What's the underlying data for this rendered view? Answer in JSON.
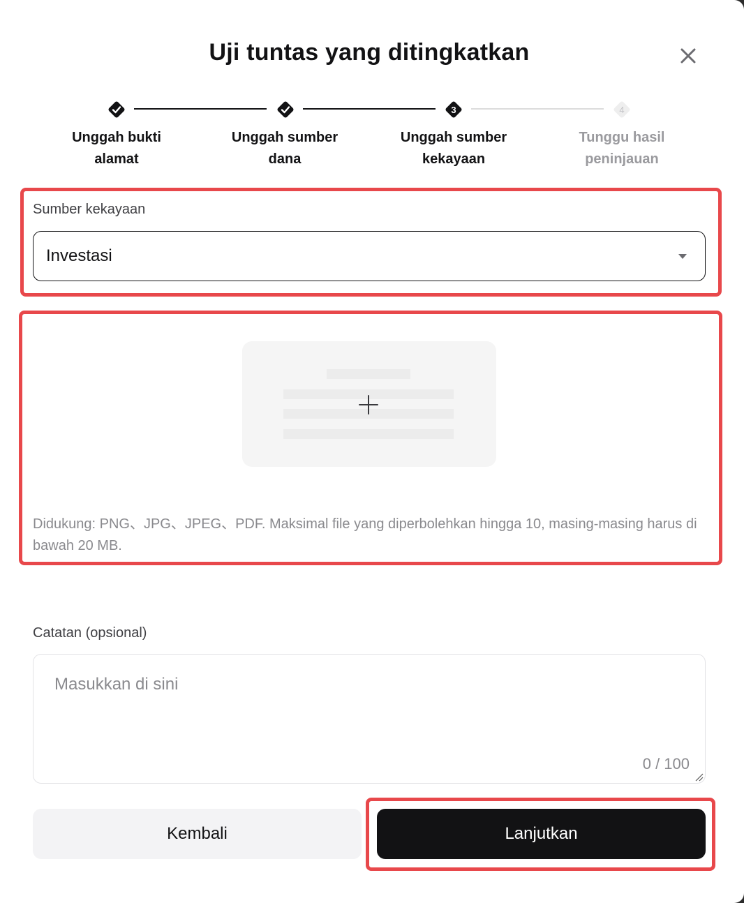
{
  "modal": {
    "title": "Uji tuntas yang ditingkatkan",
    "close_icon": "close-icon"
  },
  "stepper": {
    "steps": [
      {
        "status": "done",
        "label_line1": "Unggah bukti",
        "label_line2": "alamat"
      },
      {
        "status": "done",
        "label_line1": "Unggah sumber",
        "label_line2": "dana"
      },
      {
        "status": "current",
        "number": "3",
        "label_line1": "Unggah sumber",
        "label_line2": "kekayaan"
      },
      {
        "status": "pending",
        "number": "4",
        "label_line1": "Tunggu hasil",
        "label_line2": "peninjauan"
      }
    ]
  },
  "wealth_source": {
    "label": "Sumber kekayaan",
    "selected": "Investasi",
    "caret_icon": "caret-down-icon"
  },
  "upload": {
    "icon": "plus-icon",
    "note": "Didukung: PNG、JPG、JPEG、PDF. Maksimal file yang diperbolehkan hingga 10, masing-masing harus di bawah 20 MB."
  },
  "notes": {
    "label": "Catatan (opsional)",
    "placeholder": "Masukkan di sini",
    "counter": "0 / 100"
  },
  "actions": {
    "back_label": "Kembali",
    "next_label": "Lanjutkan"
  },
  "colors": {
    "primary": "#121214",
    "highlight": "#e8484b",
    "muted": "#8a8a8e",
    "surface": "#f5f5f5"
  }
}
